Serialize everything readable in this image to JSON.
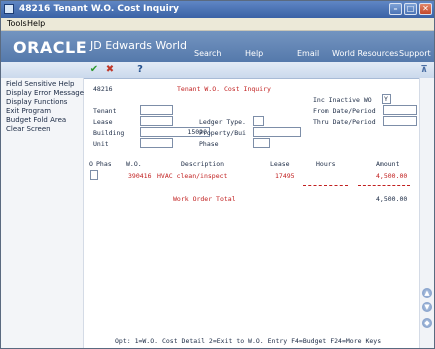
{
  "window": {
    "title": "48216   Tenant W.O. Cost Inquiry"
  },
  "menu": [
    "Tools",
    "Help"
  ],
  "banner": {
    "brand": "ORACLE",
    "product": "JD Edwards World",
    "nav": [
      "Search",
      "Help",
      "Email",
      "World Resources",
      "Support"
    ]
  },
  "sidebar": [
    "Field Sensitive Help",
    "Display Error Message",
    "Display Functions",
    "Exit Program",
    "Budget Fold Area",
    "Clear Screen"
  ],
  "form": {
    "program_id": "48216",
    "title": "Tenant W.O. Cost Inquiry",
    "inc_inactive_label": "Inc Inactive WO",
    "inc_inactive_value": "Y",
    "from_date_label": "From Date/Period",
    "thru_date_label": "Thru Date/Period",
    "tenant_label": "Tenant",
    "lease_label": "Lease",
    "building_label": "Building",
    "building_value": "15020",
    "unit_label": "Unit",
    "ledger_label": "Ledger Type.",
    "property_label": "Property/Bui",
    "phase_label": "Phase"
  },
  "grid": {
    "headers": {
      "o": "O",
      "phas": "Phas",
      "wo": "W.O.",
      "description": "Description",
      "lease": "Lease",
      "hours": "Hours",
      "amount": "Amount"
    },
    "rows": [
      {
        "wo": "390416",
        "description": "HVAC clean/inspect",
        "lease": "17495",
        "amount": "4,500.00"
      }
    ],
    "total_label": "Work Order Total",
    "total_amount": "4,500.00"
  },
  "footer": "Opt:  1=W.O. Cost Detail  2=Exit to W.O. Entry    F4=Budget  F24=More Keys"
}
